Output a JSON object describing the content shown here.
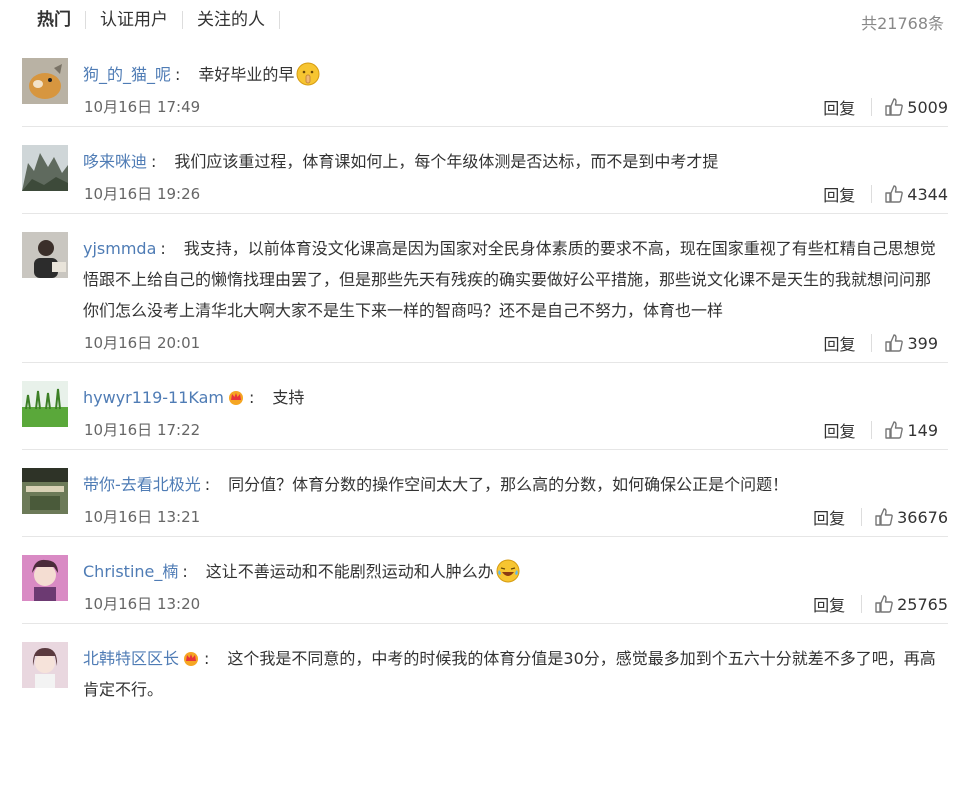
{
  "tabs": [
    "热门",
    "认证用户",
    "关注的人"
  ],
  "total": "共21768条",
  "reply_label": "回复",
  "comments": [
    {
      "user": "狗_的_猫_呢",
      "text": "幸好毕业的早",
      "time": "10月16日 17:49",
      "likes": "5009",
      "vip": false,
      "emoji": "shush-emoji-icon"
    },
    {
      "user": "哆来咪迪",
      "text": "我们应该重过程，体育课如何上，每个年级体测是否达标，而不是到中考才提",
      "time": "10月16日 19:26",
      "likes": "4344",
      "vip": false,
      "emoji": ""
    },
    {
      "user": "yjsmmda",
      "text": "我支持，以前体育没文化课高是因为国家对全民身体素质的要求不高，现在国家重视了有些杠精自己思想觉悟跟不上给自己的懒惰找理由罢了，但是那些先天有残疾的确实要做好公平措施，那些说文化课不是天生的我就想问问那你们怎么没考上清华北大啊大家不是生下来一样的智商吗？还不是自己不努力，体育也一样",
      "time": "10月16日 20:01",
      "likes": "399",
      "vip": false,
      "emoji": ""
    },
    {
      "user": "hywyr119-11Kam",
      "text": "支持",
      "time": "10月16日 17:22",
      "likes": "149",
      "vip": true,
      "emoji": ""
    },
    {
      "user": "带你-去看北极光",
      "text": "同分值？体育分数的操作空间太大了，那么高的分数，如何确保公正是个问题！",
      "time": "10月16日 13:21",
      "likes": "36676",
      "vip": false,
      "emoji": ""
    },
    {
      "user": "Christine_楠",
      "text": "这让不善运动和不能剧烈运动和人肿么办",
      "time": "10月16日 13:20",
      "likes": "25765",
      "vip": false,
      "emoji": "laugh-cry-emoji-icon"
    },
    {
      "user": "北韩特区区长",
      "text": "这个我是不同意的，中考的时候我的体育分值是30分，感觉最多加到个五六十分就差不多了吧，再高肯定不行。",
      "time": "",
      "likes": "",
      "vip": true,
      "emoji": ""
    }
  ],
  "colors": {
    "link": "#4f7cb5",
    "text": "#333333",
    "meta": "#666666",
    "divider": "#e6e6e6"
  }
}
